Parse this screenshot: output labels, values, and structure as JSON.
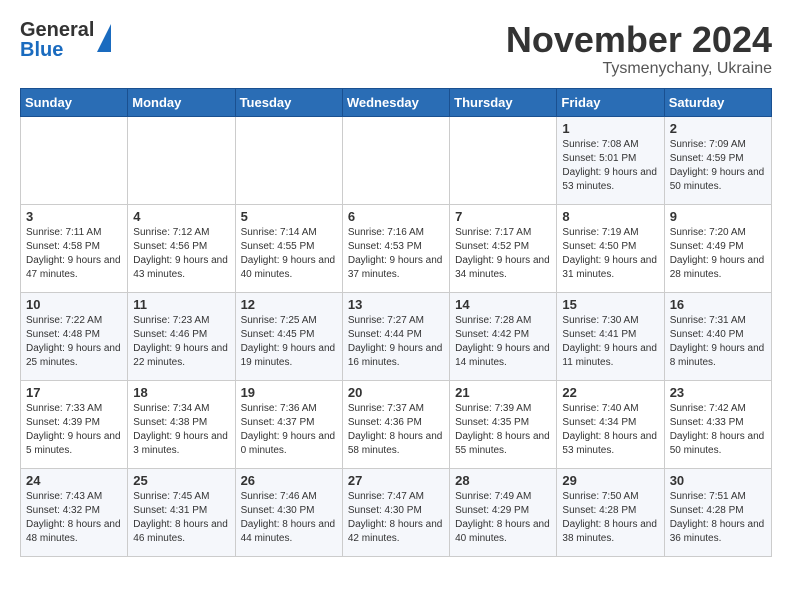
{
  "logo": {
    "general": "General",
    "blue": "Blue"
  },
  "title": "November 2024",
  "location": "Tysmenychany, Ukraine",
  "headers": [
    "Sunday",
    "Monday",
    "Tuesday",
    "Wednesday",
    "Thursday",
    "Friday",
    "Saturday"
  ],
  "weeks": [
    {
      "days": [
        {
          "num": "",
          "info": ""
        },
        {
          "num": "",
          "info": ""
        },
        {
          "num": "",
          "info": ""
        },
        {
          "num": "",
          "info": ""
        },
        {
          "num": "",
          "info": ""
        },
        {
          "num": "1",
          "info": "Sunrise: 7:08 AM\nSunset: 5:01 PM\nDaylight: 9 hours\nand 53 minutes."
        },
        {
          "num": "2",
          "info": "Sunrise: 7:09 AM\nSunset: 4:59 PM\nDaylight: 9 hours\nand 50 minutes."
        }
      ]
    },
    {
      "days": [
        {
          "num": "3",
          "info": "Sunrise: 7:11 AM\nSunset: 4:58 PM\nDaylight: 9 hours\nand 47 minutes."
        },
        {
          "num": "4",
          "info": "Sunrise: 7:12 AM\nSunset: 4:56 PM\nDaylight: 9 hours\nand 43 minutes."
        },
        {
          "num": "5",
          "info": "Sunrise: 7:14 AM\nSunset: 4:55 PM\nDaylight: 9 hours\nand 40 minutes."
        },
        {
          "num": "6",
          "info": "Sunrise: 7:16 AM\nSunset: 4:53 PM\nDaylight: 9 hours\nand 37 minutes."
        },
        {
          "num": "7",
          "info": "Sunrise: 7:17 AM\nSunset: 4:52 PM\nDaylight: 9 hours\nand 34 minutes."
        },
        {
          "num": "8",
          "info": "Sunrise: 7:19 AM\nSunset: 4:50 PM\nDaylight: 9 hours\nand 31 minutes."
        },
        {
          "num": "9",
          "info": "Sunrise: 7:20 AM\nSunset: 4:49 PM\nDaylight: 9 hours\nand 28 minutes."
        }
      ]
    },
    {
      "days": [
        {
          "num": "10",
          "info": "Sunrise: 7:22 AM\nSunset: 4:48 PM\nDaylight: 9 hours\nand 25 minutes."
        },
        {
          "num": "11",
          "info": "Sunrise: 7:23 AM\nSunset: 4:46 PM\nDaylight: 9 hours\nand 22 minutes."
        },
        {
          "num": "12",
          "info": "Sunrise: 7:25 AM\nSunset: 4:45 PM\nDaylight: 9 hours\nand 19 minutes."
        },
        {
          "num": "13",
          "info": "Sunrise: 7:27 AM\nSunset: 4:44 PM\nDaylight: 9 hours\nand 16 minutes."
        },
        {
          "num": "14",
          "info": "Sunrise: 7:28 AM\nSunset: 4:42 PM\nDaylight: 9 hours\nand 14 minutes."
        },
        {
          "num": "15",
          "info": "Sunrise: 7:30 AM\nSunset: 4:41 PM\nDaylight: 9 hours\nand 11 minutes."
        },
        {
          "num": "16",
          "info": "Sunrise: 7:31 AM\nSunset: 4:40 PM\nDaylight: 9 hours\nand 8 minutes."
        }
      ]
    },
    {
      "days": [
        {
          "num": "17",
          "info": "Sunrise: 7:33 AM\nSunset: 4:39 PM\nDaylight: 9 hours\nand 5 minutes."
        },
        {
          "num": "18",
          "info": "Sunrise: 7:34 AM\nSunset: 4:38 PM\nDaylight: 9 hours\nand 3 minutes."
        },
        {
          "num": "19",
          "info": "Sunrise: 7:36 AM\nSunset: 4:37 PM\nDaylight: 9 hours\nand 0 minutes."
        },
        {
          "num": "20",
          "info": "Sunrise: 7:37 AM\nSunset: 4:36 PM\nDaylight: 8 hours\nand 58 minutes."
        },
        {
          "num": "21",
          "info": "Sunrise: 7:39 AM\nSunset: 4:35 PM\nDaylight: 8 hours\nand 55 minutes."
        },
        {
          "num": "22",
          "info": "Sunrise: 7:40 AM\nSunset: 4:34 PM\nDaylight: 8 hours\nand 53 minutes."
        },
        {
          "num": "23",
          "info": "Sunrise: 7:42 AM\nSunset: 4:33 PM\nDaylight: 8 hours\nand 50 minutes."
        }
      ]
    },
    {
      "days": [
        {
          "num": "24",
          "info": "Sunrise: 7:43 AM\nSunset: 4:32 PM\nDaylight: 8 hours\nand 48 minutes."
        },
        {
          "num": "25",
          "info": "Sunrise: 7:45 AM\nSunset: 4:31 PM\nDaylight: 8 hours\nand 46 minutes."
        },
        {
          "num": "26",
          "info": "Sunrise: 7:46 AM\nSunset: 4:30 PM\nDaylight: 8 hours\nand 44 minutes."
        },
        {
          "num": "27",
          "info": "Sunrise: 7:47 AM\nSunset: 4:30 PM\nDaylight: 8 hours\nand 42 minutes."
        },
        {
          "num": "28",
          "info": "Sunrise: 7:49 AM\nSunset: 4:29 PM\nDaylight: 8 hours\nand 40 minutes."
        },
        {
          "num": "29",
          "info": "Sunrise: 7:50 AM\nSunset: 4:28 PM\nDaylight: 8 hours\nand 38 minutes."
        },
        {
          "num": "30",
          "info": "Sunrise: 7:51 AM\nSunset: 4:28 PM\nDaylight: 8 hours\nand 36 minutes."
        }
      ]
    }
  ]
}
